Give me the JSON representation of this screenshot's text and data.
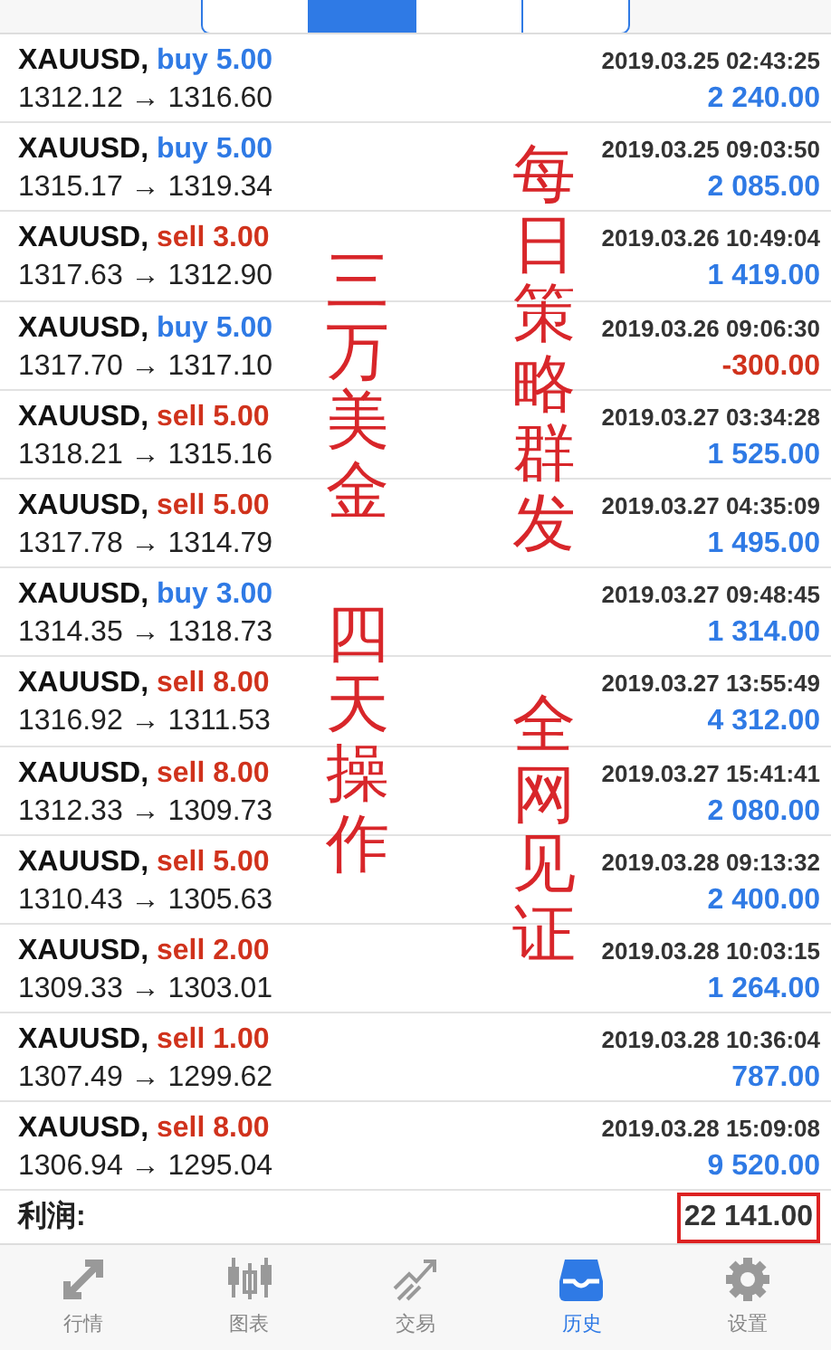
{
  "period_tabs": [
    {
      "selected": false
    },
    {
      "selected": true
    },
    {
      "selected": false
    },
    {
      "selected": false
    }
  ],
  "trades": [
    {
      "symbol": "XAUUSD,",
      "sell": false,
      "action": "buy 5.00",
      "time": "2019.03.25 02:43:25",
      "prices": "1312.12 → 1316.60",
      "profit": "2 240.00",
      "loss": false
    },
    {
      "symbol": "XAUUSD,",
      "sell": false,
      "action": "buy 5.00",
      "time": "2019.03.25 09:03:50",
      "prices": "1315.17 → 1319.34",
      "profit": "2 085.00",
      "loss": false
    },
    {
      "symbol": "XAUUSD,",
      "sell": true,
      "action": "sell 3.00",
      "time": "2019.03.26 10:49:04",
      "prices": "1317.63 → 1312.90",
      "profit": "1 419.00",
      "loss": false
    },
    {
      "symbol": "XAUUSD,",
      "sell": false,
      "action": "buy 5.00",
      "time": "2019.03.26 09:06:30",
      "prices": "1317.70 → 1317.10",
      "profit": "-300.00",
      "loss": true
    },
    {
      "symbol": "XAUUSD,",
      "sell": true,
      "action": "sell 5.00",
      "time": "2019.03.27 03:34:28",
      "prices": "1318.21 → 1315.16",
      "profit": "1 525.00",
      "loss": false
    },
    {
      "symbol": "XAUUSD,",
      "sell": true,
      "action": "sell 5.00",
      "time": "2019.03.27 04:35:09",
      "prices": "1317.78 → 1314.79",
      "profit": "1 495.00",
      "loss": false
    },
    {
      "symbol": "XAUUSD,",
      "sell": false,
      "action": "buy 3.00",
      "time": "2019.03.27 09:48:45",
      "prices": "1314.35 → 1318.73",
      "profit": "1 314.00",
      "loss": false
    },
    {
      "symbol": "XAUUSD,",
      "sell": true,
      "action": "sell 8.00",
      "time": "2019.03.27 13:55:49",
      "prices": "1316.92 → 1311.53",
      "profit": "4 312.00",
      "loss": false
    },
    {
      "symbol": "XAUUSD,",
      "sell": true,
      "action": "sell 8.00",
      "time": "2019.03.27 15:41:41",
      "prices": "1312.33 → 1309.73",
      "profit": "2 080.00",
      "loss": false
    },
    {
      "symbol": "XAUUSD,",
      "sell": true,
      "action": "sell 5.00",
      "time": "2019.03.28 09:13:32",
      "prices": "1310.43 → 1305.63",
      "profit": "2 400.00",
      "loss": false
    },
    {
      "symbol": "XAUUSD,",
      "sell": true,
      "action": "sell 2.00",
      "time": "2019.03.28 10:03:15",
      "prices": "1309.33 → 1303.01",
      "profit": "1 264.00",
      "loss": false
    },
    {
      "symbol": "XAUUSD,",
      "sell": true,
      "action": "sell 1.00",
      "time": "2019.03.28 10:36:04",
      "prices": "1307.49 → 1299.62",
      "profit": "787.00",
      "loss": false
    },
    {
      "symbol": "XAUUSD,",
      "sell": true,
      "action": "sell 8.00",
      "time": "2019.03.28 15:09:08",
      "prices": "1306.94 → 1295.04",
      "profit": "9 520.00",
      "loss": false
    }
  ],
  "total": {
    "label": "利润:",
    "value": "22 141.00"
  },
  "overlay_texts": [
    "每日策略群发",
    "三万美金",
    "四天操作",
    "全网见证"
  ],
  "tab_bar": [
    {
      "kind": "quotes",
      "label": "行情",
      "selected": false
    },
    {
      "kind": "chart",
      "label": "图表",
      "selected": false
    },
    {
      "kind": "trade",
      "label": "交易",
      "selected": false
    },
    {
      "kind": "history",
      "label": "历史",
      "selected": true
    },
    {
      "kind": "settings",
      "label": "设置",
      "selected": false
    }
  ]
}
